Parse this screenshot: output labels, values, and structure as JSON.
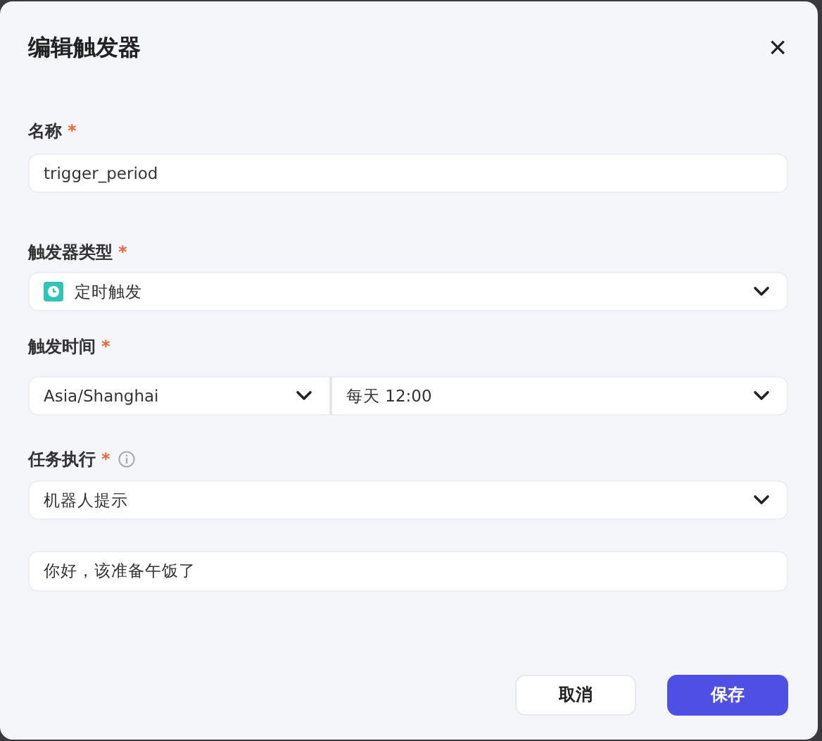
{
  "dialog": {
    "title": "编辑触发器",
    "close": "×"
  },
  "fields": [
    {
      "label": "名称",
      "required_mark": "*",
      "info": false,
      "controls": [
        {
          "kind": "input",
          "value": "trigger_period"
        }
      ]
    },
    {
      "label": "触发器类型",
      "required_mark": "*",
      "info": false,
      "controls": [
        {
          "kind": "select_icon",
          "value": "定时触发"
        }
      ]
    },
    {
      "label": "触发时间",
      "required_mark": "*",
      "info": false,
      "controls": [
        {
          "kind": "select",
          "value": "Asia/Shanghai"
        },
        {
          "kind": "select",
          "value": "每天 12:00"
        }
      ]
    },
    {
      "label": "任务执行",
      "required_mark": "*",
      "info": true,
      "controls": [
        {
          "kind": "select",
          "value": "机器人提示"
        }
      ]
    },
    {
      "controls": [
        {
          "kind": "input",
          "value": "你好，该准备午饭了"
        }
      ]
    }
  ],
  "buttons": [
    {
      "label": "取消",
      "kind": "secondary"
    },
    {
      "label": "保存",
      "kind": "primary"
    }
  ]
}
